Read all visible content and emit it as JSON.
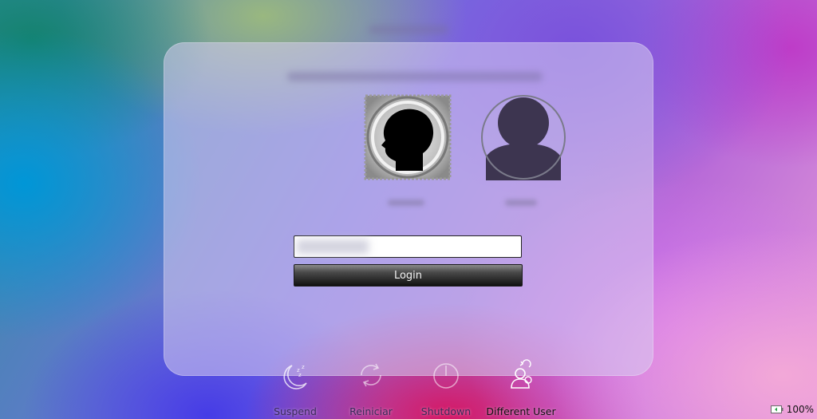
{
  "login": {
    "users": [
      {
        "name": "",
        "avatar_icon": "head-silhouette-avatar-icon"
      },
      {
        "name": "",
        "avatar_icon": "generic-user-avatar-icon"
      }
    ],
    "password_value": "",
    "password_placeholder": "",
    "login_button_label": "Login"
  },
  "actions": [
    {
      "label": "Suspend",
      "icon": "moon-sleep-icon"
    },
    {
      "label": "Reiniciar",
      "icon": "restart-icon"
    },
    {
      "label": "Shutdown",
      "icon": "power-icon"
    },
    {
      "label": "Different User",
      "icon": "switch-user-icon"
    }
  ],
  "status": {
    "battery_percent": "100%",
    "battery_icon": "battery-icon"
  },
  "colors": {
    "button_top": "#8a8a8a",
    "button_bottom": "#111111",
    "action_label": "#3a2a5a",
    "highlight_label": "#111111"
  }
}
